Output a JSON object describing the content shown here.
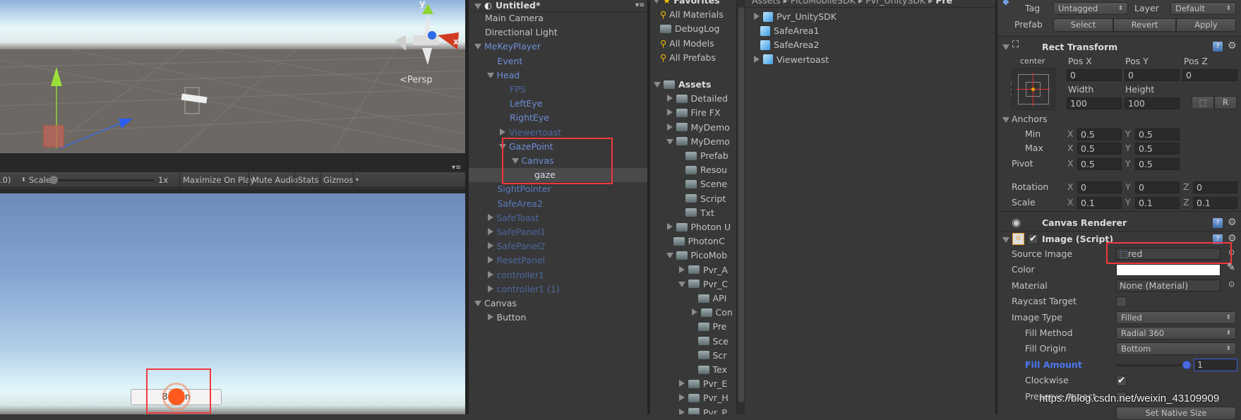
{
  "scene_view": {
    "projection_label": "Persp",
    "gizmo_axes": {
      "y": "y",
      "x": "x"
    }
  },
  "game_toolbar": {
    "aspect_partial": ".0)",
    "scale_label": "Scale",
    "scale_value": "1x",
    "scale_fraction": 0,
    "maximize_on_play": "Maximize On Play",
    "mute_audio": "Mute Audio",
    "stats": "Stats",
    "gizmos": "Gizmos"
  },
  "game_view": {
    "button_label": "Button"
  },
  "hierarchy": {
    "title": "Untitled*",
    "items": [
      {
        "label": "Main Camera",
        "depth": 0,
        "arrow": "none",
        "color": "#c4c4c4"
      },
      {
        "label": "Directional Light",
        "depth": 0,
        "arrow": "none",
        "color": "#c4c4c4"
      },
      {
        "label": "MeKeyPlayer",
        "depth": 0,
        "arrow": "down",
        "color": "#6e8fd8"
      },
      {
        "label": "Event",
        "depth": 1,
        "arrow": "none",
        "color": "#6e8fd8"
      },
      {
        "label": "Head",
        "depth": 1,
        "arrow": "down",
        "color": "#6e8fd8"
      },
      {
        "label": "FPS",
        "depth": 2,
        "arrow": "none",
        "color": "#4c67a0"
      },
      {
        "label": "LeftEye",
        "depth": 2,
        "arrow": "none",
        "color": "#6e8fd8"
      },
      {
        "label": "RightEye",
        "depth": 2,
        "arrow": "none",
        "color": "#6e8fd8"
      },
      {
        "label": "Viewertoast",
        "depth": 2,
        "arrow": "right",
        "color": "#4c67a0"
      },
      {
        "label": "GazePoint",
        "depth": 2,
        "arrow": "down",
        "color": "#6e8fd8"
      },
      {
        "label": "Canvas",
        "depth": 3,
        "arrow": "down",
        "color": "#6e8fd8"
      },
      {
        "label": "gaze",
        "depth": 4,
        "arrow": "none",
        "color": "#d8dcec",
        "selected": true
      },
      {
        "label": "SightPointer",
        "depth": 1,
        "arrow": "none",
        "color": "#5a7bc0"
      },
      {
        "label": "SafeArea2",
        "depth": 1,
        "arrow": "none",
        "color": "#5a7bc0"
      },
      {
        "label": "SafeToast",
        "depth": 1,
        "arrow": "right",
        "color": "#4c67a0"
      },
      {
        "label": "SafePanel1",
        "depth": 1,
        "arrow": "right",
        "color": "#4c67a0"
      },
      {
        "label": "SafePanel2",
        "depth": 1,
        "arrow": "right",
        "color": "#4c67a0"
      },
      {
        "label": "ResetPanel",
        "depth": 1,
        "arrow": "right",
        "color": "#4c67a0"
      },
      {
        "label": "controller1",
        "depth": 1,
        "arrow": "right",
        "color": "#4c67a0"
      },
      {
        "label": "controller1 (1)",
        "depth": 1,
        "arrow": "right",
        "color": "#4c67a0"
      },
      {
        "label": "Canvas",
        "depth": 0,
        "arrow": "down",
        "color": "#c4c4c4"
      },
      {
        "label": "Button",
        "depth": 1,
        "arrow": "right",
        "color": "#c4c4c4"
      }
    ]
  },
  "project": {
    "favorites": {
      "title": "Favorites",
      "items": [
        {
          "label": "All Materials",
          "icon": "search"
        },
        {
          "label": "DebugLog",
          "icon": "folder-star"
        },
        {
          "label": "All Models",
          "icon": "search"
        },
        {
          "label": "All Prefabs",
          "icon": "search"
        }
      ]
    },
    "assets_tree": [
      {
        "label": "Assets",
        "depth": 0,
        "arrow": "down",
        "bold": true
      },
      {
        "label": "Detailed",
        "depth": 1,
        "arrow": "right"
      },
      {
        "label": "Fire FX",
        "depth": 1,
        "arrow": "right"
      },
      {
        "label": "MyDemo",
        "depth": 1,
        "arrow": "right"
      },
      {
        "label": "MyDemo",
        "depth": 1,
        "arrow": "down"
      },
      {
        "label": "Prefab",
        "depth": 2,
        "arrow": "none"
      },
      {
        "label": "Resou",
        "depth": 2,
        "arrow": "none"
      },
      {
        "label": "Scene",
        "depth": 2,
        "arrow": "none"
      },
      {
        "label": "Script",
        "depth": 2,
        "arrow": "none"
      },
      {
        "label": "Txt",
        "depth": 2,
        "arrow": "none"
      },
      {
        "label": "Photon U",
        "depth": 1,
        "arrow": "right"
      },
      {
        "label": "PhotonC",
        "depth": 1,
        "arrow": "none"
      },
      {
        "label": "PicoMob",
        "depth": 1,
        "arrow": "down"
      },
      {
        "label": "Pvr_A",
        "depth": 2,
        "arrow": "right"
      },
      {
        "label": "Pvr_C",
        "depth": 2,
        "arrow": "down"
      },
      {
        "label": "API",
        "depth": 3,
        "arrow": "none"
      },
      {
        "label": "Con",
        "depth": 3,
        "arrow": "right"
      },
      {
        "label": "Pre",
        "depth": 3,
        "arrow": "none"
      },
      {
        "label": "Sce",
        "depth": 3,
        "arrow": "none"
      },
      {
        "label": "Scr",
        "depth": 3,
        "arrow": "none"
      },
      {
        "label": "Tex",
        "depth": 3,
        "arrow": "none"
      },
      {
        "label": "Pvr_E",
        "depth": 2,
        "arrow": "right"
      },
      {
        "label": "Pvr_H",
        "depth": 2,
        "arrow": "right"
      },
      {
        "label": "Pvr_P",
        "depth": 2,
        "arrow": "right"
      }
    ],
    "breadcrumb": [
      "Assets",
      "PicoMobileSDK",
      "Pvr_UnitySDK",
      "Pre"
    ],
    "content_items": [
      {
        "label": "Pvr_UnitySDK",
        "arrow": true
      },
      {
        "label": "SafeArea1",
        "arrow": false
      },
      {
        "label": "SafeArea2",
        "arrow": false
      },
      {
        "label": "Viewertoast",
        "arrow": true
      }
    ]
  },
  "inspector": {
    "tag_label": "Tag",
    "tag_value": "Untagged",
    "layer_label": "Layer",
    "layer_value": "Default",
    "prefab_label": "Prefab",
    "prefab_select": "Select",
    "prefab_revert": "Revert",
    "prefab_apply": "Apply",
    "rect_transform": {
      "title": "Rect Transform",
      "anchor_h": "center",
      "anchor_v": "middle",
      "pos_x_label": "Pos X",
      "pos_y_label": "Pos Y",
      "pos_z_label": "Pos Z",
      "pos_x": "0",
      "pos_y": "0",
      "pos_z": "0",
      "width_label": "Width",
      "height_label": "Height",
      "width": "100",
      "height": "100",
      "raw_edit_btn": "R",
      "anchors_label": "Anchors",
      "min_label": "Min",
      "min_x": "0.5",
      "min_y": "0.5",
      "max_label": "Max",
      "max_x": "0.5",
      "max_y": "0.5",
      "pivot_label": "Pivot",
      "pivot_x": "0.5",
      "pivot_y": "0.5",
      "rotation_label": "Rotation",
      "rot_x": "0",
      "rot_y": "0",
      "rot_z": "0",
      "scale_label": "Scale",
      "scale_x": "0.1",
      "scale_y": "0.1",
      "scale_z": "0.1",
      "x": "X",
      "y": "Y",
      "z": "Z"
    },
    "canvas_renderer": {
      "title": "Canvas Renderer"
    },
    "image": {
      "title": "Image (Script)",
      "enabled": true,
      "source_image_label": "Source Image",
      "source_image": "red",
      "color_label": "Color",
      "color_value": "#ffffff",
      "material_label": "Material",
      "material": "None (Material)",
      "raycast_label": "Raycast Target",
      "raycast": false,
      "image_type_label": "Image Type",
      "image_type": "Filled",
      "fill_method_label": "Fill Method",
      "fill_method": "Radial 360",
      "fill_origin_label": "Fill Origin",
      "fill_origin": "Bottom",
      "fill_amount_label": "Fill Amount",
      "fill_amount": "1",
      "clockwise_label": "Clockwise",
      "clockwise": true,
      "preserve_aspect_label": "Preserve Aspect",
      "preserve_aspect": false,
      "set_native_size": "Set Native Size"
    }
  },
  "watermark": "https://blog.csdn.net/weixin_43109909",
  "colors": {
    "highlight_red": "#f2383a",
    "prefab_blue": "#6e8fd8",
    "fill_amount_blue": "#4a78f0",
    "gaze_orange": "#ff5a1e"
  }
}
